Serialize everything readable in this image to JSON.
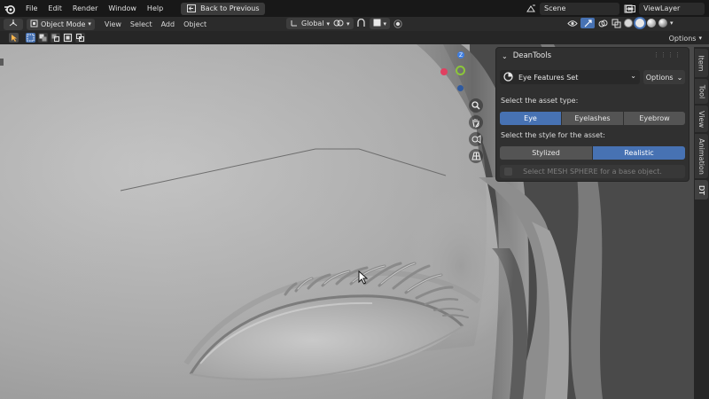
{
  "topbar": {
    "menus": [
      "File",
      "Edit",
      "Render",
      "Window",
      "Help"
    ],
    "back_button": "Back to Previous",
    "scene": "Scene",
    "view_layer": "ViewLayer"
  },
  "viewport_header": {
    "mode": "Object Mode",
    "menus": [
      "View",
      "Select",
      "Add",
      "Object"
    ],
    "orientation": "Global"
  },
  "tool_header": {
    "options": "Options"
  },
  "gizmo": {
    "z_label": "Z",
    "y_label": "Y",
    "x_color": "#e04060",
    "y_color": "#8cc63a",
    "z_color": "#3f7ee0"
  },
  "npanel": {
    "title": "DeanTools",
    "asset_set": "Eye Features Set",
    "options_label": "Options",
    "asset_type_label": "Select the asset type:",
    "asset_types": [
      "Eye",
      "Eyelashes",
      "Eyebrow"
    ],
    "asset_type_selected": "Eye",
    "style_label": "Select the style for the asset:",
    "styles": [
      "Stylized",
      "Realistic"
    ],
    "style_selected": "Realistic",
    "base_hint": "Select MESH SPHERE for a base object."
  },
  "side_tabs": [
    "Item",
    "Tool",
    "View",
    "Animation",
    "DT"
  ],
  "colors": {
    "accent": "#4772b3",
    "panel": "#303030",
    "header": "#181818"
  }
}
